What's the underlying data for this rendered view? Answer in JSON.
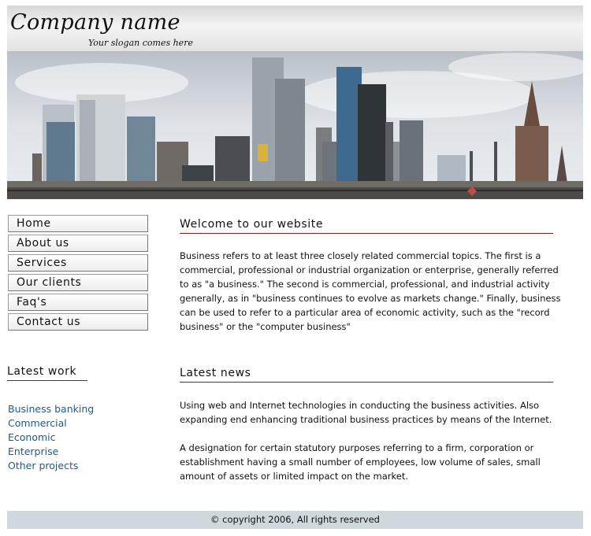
{
  "header": {
    "company_name": "Company name",
    "slogan": "Your slogan comes here"
  },
  "nav": {
    "items": [
      "Home",
      "About us",
      "Services",
      "Our clients",
      "Faq's",
      "Contact us"
    ]
  },
  "latest_work": {
    "title": "Latest work",
    "links": [
      "Business banking",
      "Commercial",
      "Economic",
      "Enterprise",
      "Other projects"
    ]
  },
  "welcome": {
    "title": "Welcome to our website",
    "text": "Business refers to at least three closely related commercial topics. The first is a commercial, professional or industrial organization or enterprise, generally referred to as \"a business.\" The second is commercial, professional, and industrial activity generally, as in \"business continues to evolve as markets change.\" Finally, business can be used to refer to a particular area of economic activity, such as the \"record business\" or the \"computer business\""
  },
  "news": {
    "title": "Latest news",
    "paragraph1": "Using web and Internet technologies in conducting the business activities. Also expanding end enhancing traditional business practices by means of the Internet.",
    "paragraph2": "A designation for certain statutory purposes referring to a firm, corporation or establishment having a small number of employees, low volume of sales, small amount of assets or limited impact on the market."
  },
  "footer": {
    "copyright": "© copyright 2006, All rights reserved"
  },
  "colors": {
    "link": "#1b5a8e",
    "heading_rule": "#8b1a1a",
    "footer_bg": "#cfd8dd"
  }
}
